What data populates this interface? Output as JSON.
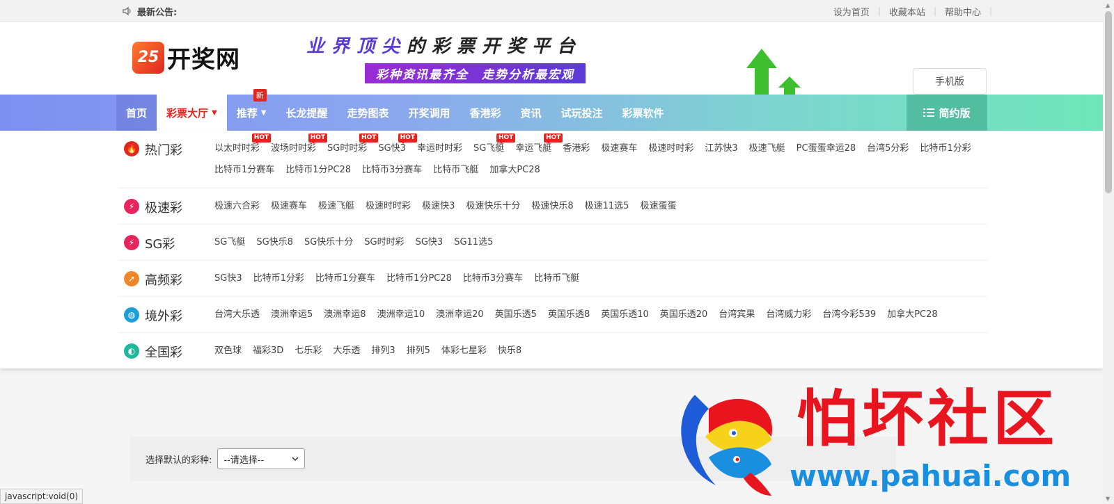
{
  "topbar": {
    "notice_label": "最新公告:",
    "links": [
      "设为首页",
      "收藏本站",
      "帮助中心"
    ]
  },
  "header": {
    "logo_badge": "25",
    "logo_text": "开奖网",
    "banner_title_a": "业界顶尖",
    "banner_title_b": "的彩票开奖平台",
    "banner_subtitle": "彩种资讯最齐全　走势分析最宏观",
    "mobile_button": "手机版"
  },
  "nav": {
    "items": [
      {
        "label": "首页"
      },
      {
        "label": "彩票大厅"
      },
      {
        "label": "推荐",
        "badge": "新"
      },
      {
        "label": "长龙提醒"
      },
      {
        "label": "走势图表"
      },
      {
        "label": "开奖调用"
      },
      {
        "label": "香港彩"
      },
      {
        "label": "资讯"
      },
      {
        "label": "试玩投注"
      },
      {
        "label": "彩票软件"
      }
    ],
    "simple_label": "简约版"
  },
  "hot_badge": "HOT",
  "categories": [
    {
      "name": "热门彩",
      "icon": "flame-icon",
      "color": "#e0261f",
      "glyph": "🔥",
      "items": [
        "以太时时彩",
        "波场时时彩",
        "SG时时彩",
        "SG快3",
        "幸运时时彩",
        "SG飞艇",
        "幸运飞艇",
        "香港彩",
        "极速赛车",
        "极速时时彩",
        "江苏快3",
        "极速飞艇",
        "PC蛋蛋幸运28",
        "台湾5分彩",
        "比特币1分彩",
        "比特币1分赛车",
        "比特币1分PC28",
        "比特币3分赛车",
        "比特币飞艇",
        "加拿大PC28"
      ],
      "hot": [
        0,
        1,
        2,
        3,
        5,
        6
      ]
    },
    {
      "name": "极速彩",
      "icon": "lightning-icon",
      "color": "#e8245c",
      "glyph": "⚡",
      "items": [
        "极速六合彩",
        "极速赛车",
        "极速飞艇",
        "极速时时彩",
        "极速快3",
        "极速快乐十分",
        "极速快乐8",
        "极速11选5",
        "极速蛋蛋"
      ],
      "hot": []
    },
    {
      "name": "SG彩",
      "icon": "lightning-icon",
      "color": "#e8245c",
      "glyph": "⚡",
      "items": [
        "SG飞艇",
        "SG快乐8",
        "SG快乐十分",
        "SG时时彩",
        "SG快3",
        "SG11选5"
      ],
      "hot": []
    },
    {
      "name": "高频彩",
      "icon": "rocket-icon",
      "color": "#f0862a",
      "glyph": "➚",
      "items": [
        "SG快3",
        "比特币1分彩",
        "比特币1分赛车",
        "比特币1分PC28",
        "比特币3分赛车",
        "比特币飞艇"
      ],
      "hot": []
    },
    {
      "name": "境外彩",
      "icon": "world-map-icon",
      "color": "#1b9fd6",
      "glyph": "◍",
      "items": [
        "台湾大乐透",
        "澳洲幸运5",
        "澳洲幸运8",
        "澳洲幸运10",
        "澳洲幸运20",
        "英国乐透5",
        "英国乐透8",
        "英国乐透10",
        "英国乐透20",
        "台湾宾果",
        "台湾威力彩",
        "台湾今彩539",
        "加拿大PC28"
      ],
      "hot": []
    },
    {
      "name": "全国彩",
      "icon": "china-map-icon",
      "color": "#1fb89c",
      "glyph": "◐",
      "items": [
        "双色球",
        "福彩3D",
        "七乐彩",
        "大乐透",
        "排列3",
        "排列5",
        "体彩七星彩",
        "快乐8"
      ],
      "hot": []
    }
  ],
  "lower": {
    "select_label": "选择默认的彩种:",
    "select_value": "--请选择--"
  },
  "statusbar": "javascript:void(0)",
  "watermark": {
    "title": "怕坏社区",
    "url": "www.pahuai.com"
  }
}
